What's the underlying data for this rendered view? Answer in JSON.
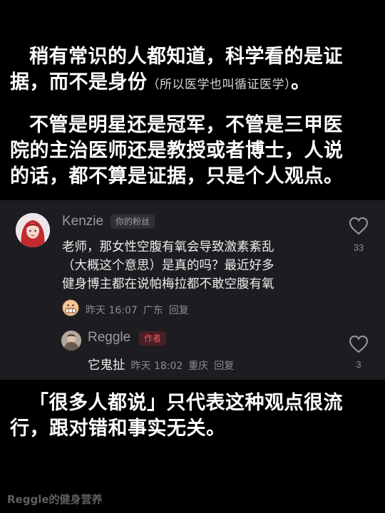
{
  "intro": {
    "line1": "稍有常识的人都知道，科学看的是证",
    "line2_main": "据，而不是身份",
    "line2_small": "（所以医学也叫循证医学）",
    "line2_end": "。",
    "para2": [
      "不管是明星还是冠军，不管是三甲医",
      "院的主治医师还是教授或者博士，人说",
      "的话，都不算是证据，只是个人观点。"
    ]
  },
  "comment": {
    "username": "Kenzie",
    "badge": "你的粉丝",
    "text_lines": [
      "老师，那女性空腹有氧会导致激素紊乱",
      "（大概这个意思）是真的吗？最近好多",
      "健身博主都在说帕梅拉都不敢空腹有氧"
    ],
    "time": "昨天 16:07",
    "location": "广东",
    "reply_label": "回复",
    "likes": "33",
    "emoji_icon": "grimacing-face-emoji"
  },
  "reply": {
    "username": "Reggle",
    "badge": "作者",
    "text": "它鬼扯",
    "time": "昨天 18:02",
    "location": "重庆",
    "reply_label": "回复",
    "likes": "3"
  },
  "outro": {
    "lines": [
      "「很多人都说」只代表这种观点很流",
      "行，跟对错和事实无关。"
    ]
  },
  "watermark": "Reggle的健身营养",
  "colors": {
    "background": "#000000",
    "comment_panel": "#1d1d21",
    "author_badge": "#f05a66",
    "muted_text": "#8a8a92"
  }
}
